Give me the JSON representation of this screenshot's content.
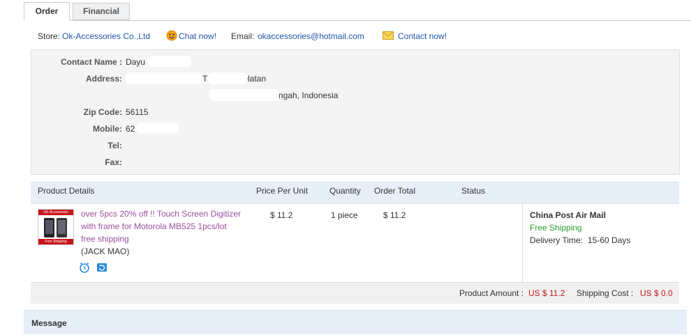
{
  "tabs": {
    "order": "Order",
    "financial": "Financial"
  },
  "store": {
    "store_label": "Store:",
    "store_name": "Ok-Accessories Co.,Ltd",
    "chat_label": "Chat now!",
    "email_label": "Email:",
    "email": "okaccessories@hotmail.com",
    "contact_label": "Contact now!"
  },
  "contact": {
    "name_label": "Contact Name :",
    "name_value": "Dayu",
    "address_label": "Address:",
    "address_line1": "T          Kramat selatan",
    "address_line2": "ngah, Indonesia",
    "zip_label": "Zip Code:",
    "zip_value": "56115",
    "mobile_label": "Mobile:",
    "mobile_value": "62              14",
    "tel_label": "Tel:",
    "fax_label": "Fax:"
  },
  "product_table": {
    "headers": {
      "details": "Product Details",
      "price": "Price Per Unit",
      "quantity": "Quantity",
      "total": "Order Total",
      "status": "Status"
    },
    "item": {
      "thumb_brand": "OK-Accessories",
      "thumb_badge": "Free Shipping",
      "title": "over 5pcs 20% off !! Touch Screen Digitizer with frame for Motorola MB525 1pcs/lot free shipping",
      "seller": "(JACK MAO)",
      "price": "$ 11.2",
      "quantity": "1 piece",
      "total": "$ 11.2",
      "shipping_method": "China Post Air Mail",
      "shipping_cost_note": "Free Shipping",
      "delivery_label": "Delivery Time:",
      "delivery_value": "15-60 Days"
    },
    "summary": {
      "product_amount_label": "Product Amount :",
      "product_amount_value": "US $ 11.2",
      "shipping_cost_label": "Shipping Cost :",
      "shipping_cost_value": "US $ 0.0"
    }
  },
  "message": {
    "header": "Message"
  },
  "colors": {
    "link": "#2255aa",
    "price_red": "#c8161d",
    "free_green": "#2e9a2e",
    "title_purple": "#9a4f9a",
    "header_blue": "#e6eff8"
  }
}
